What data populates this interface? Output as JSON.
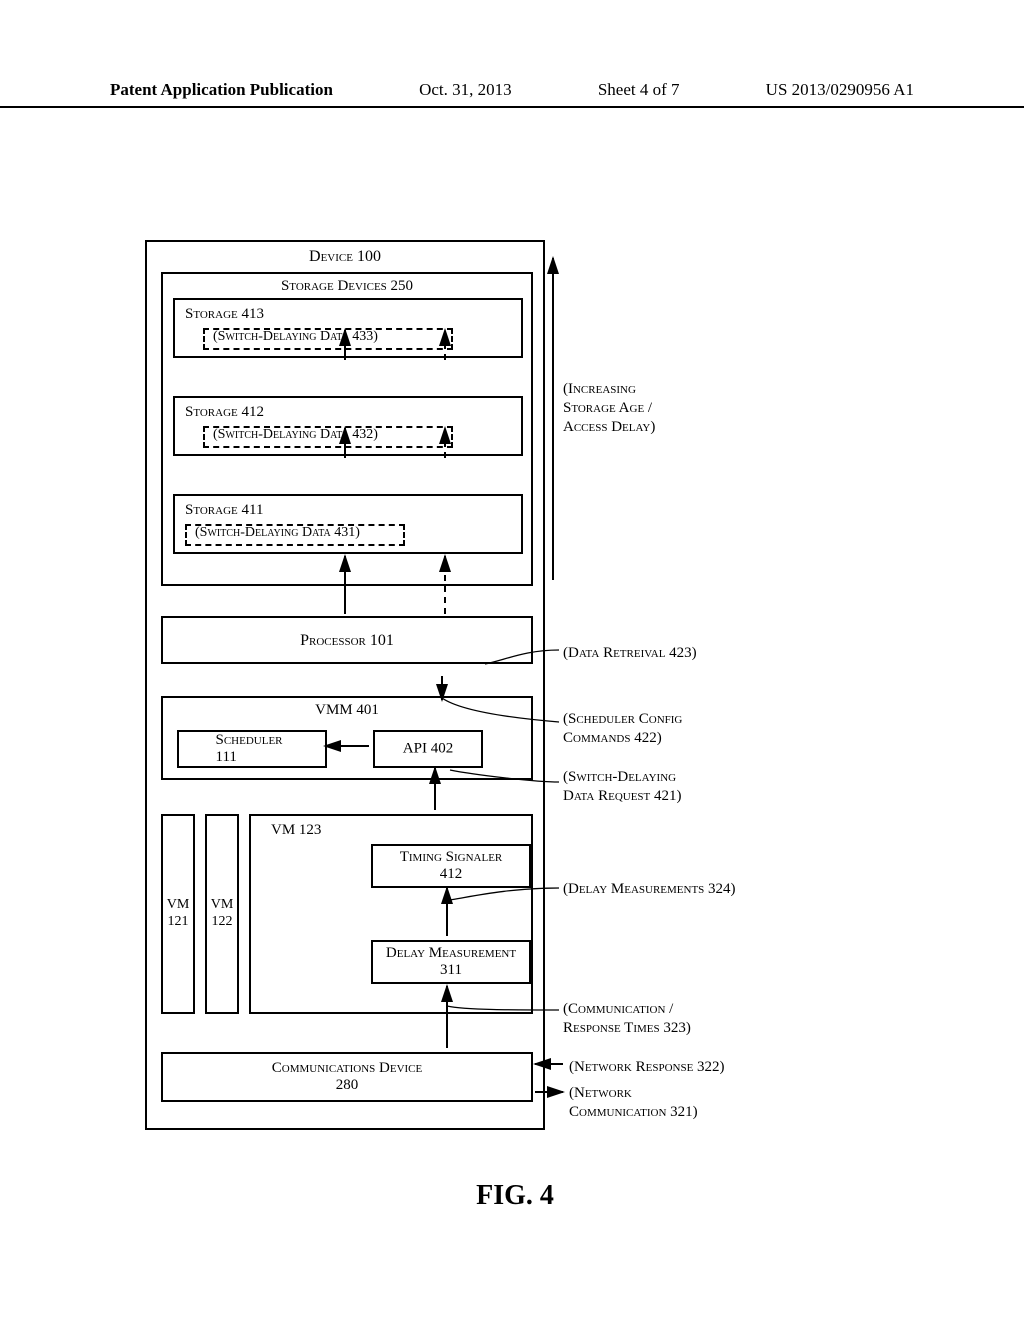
{
  "header": {
    "publication": "Patent Application Publication",
    "date": "Oct. 31, 2013",
    "sheet": "Sheet 4 of 7",
    "docnum": "US 2013/0290956 A1"
  },
  "device": {
    "title": "Device 100",
    "storage_devices": {
      "title": "Storage Devices 250",
      "s413": {
        "title": "Storage 413",
        "data": "(Switch-Delaying Data 433)"
      },
      "s412": {
        "title": "Storage 412",
        "data": "(Switch-Delaying Data 432)"
      },
      "s411": {
        "title": "Storage 411",
        "data": "(Switch-Delaying Data 431)"
      }
    },
    "processor": {
      "title": "Processor 101"
    },
    "vmm": {
      "title": "VMM 401",
      "scheduler": "Scheduler 111",
      "api": "API 402"
    },
    "vm121": "VM\n121",
    "vm122": "VM\n122",
    "vm123": {
      "title": "VM 123",
      "timing_signaler": "Timing Signaler\n412",
      "delay_measurement": "Delay Measurement\n311"
    },
    "comm": "Communications Device\n280"
  },
  "annotations": {
    "increasing": "(Increasing\nStorage Age /\nAccess Delay)",
    "data_retrieval": "(Data Retreival 423)",
    "scheduler_config": "(Scheduler Config\nCommands 422)",
    "switch_delaying_req": "(Switch-Delaying\nData Request 421)",
    "delay_measurements": "(Delay Measurements 324)",
    "comm_resp_times": "(Communication /\nResponse Times 323)",
    "network_response": "(Network Response 322)",
    "network_comm": "(Network\nCommunication 321)"
  },
  "figure_caption": "FIG. 4"
}
